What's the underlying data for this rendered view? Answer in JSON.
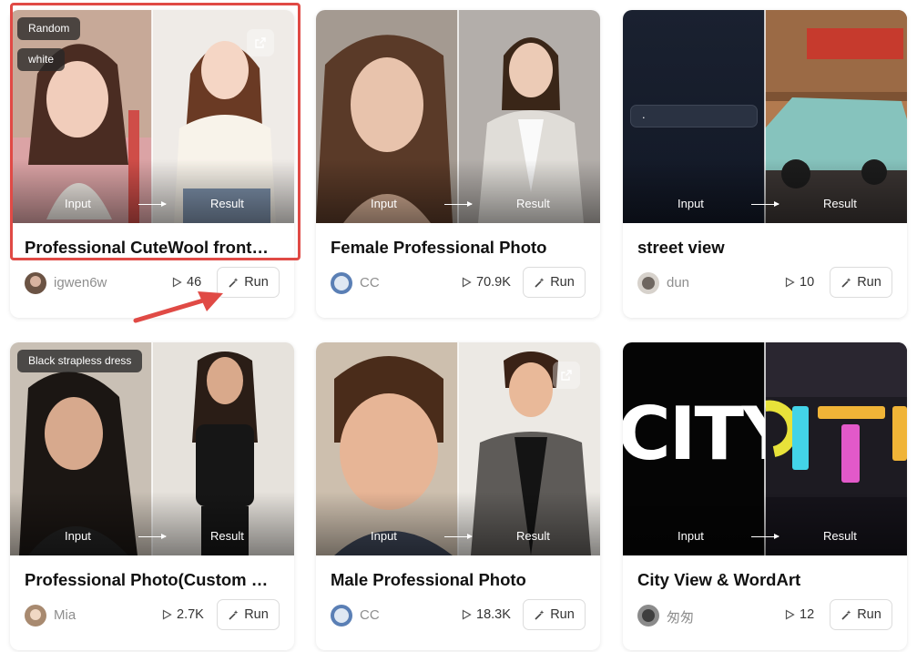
{
  "common": {
    "input_label": "Input",
    "result_label": "Result",
    "run_label": "Run"
  },
  "cards": [
    {
      "title": "Professional CuteWool front…",
      "author": "igwen6w",
      "plays": "46",
      "tags": [
        "Random",
        "white"
      ]
    },
    {
      "title": "Female Professional Photo",
      "author": "CC",
      "plays": "70.9K"
    },
    {
      "title": "street view",
      "author": "dun",
      "plays": "10",
      "input_text": "."
    },
    {
      "title": "Professional Photo(Custom …",
      "author": "Mia",
      "plays": "2.7K",
      "tags": [
        "Black strapless dress"
      ]
    },
    {
      "title": "Male Professional Photo",
      "author": "CC",
      "plays": "18.3K"
    },
    {
      "title": "City View & WordArt",
      "author": "匆匆",
      "plays": "12",
      "city_text": "CITY"
    }
  ],
  "colors": {
    "highlight": "#e04a45",
    "run_border": "#dcdcdc",
    "author_text": "#8e8e8e"
  }
}
